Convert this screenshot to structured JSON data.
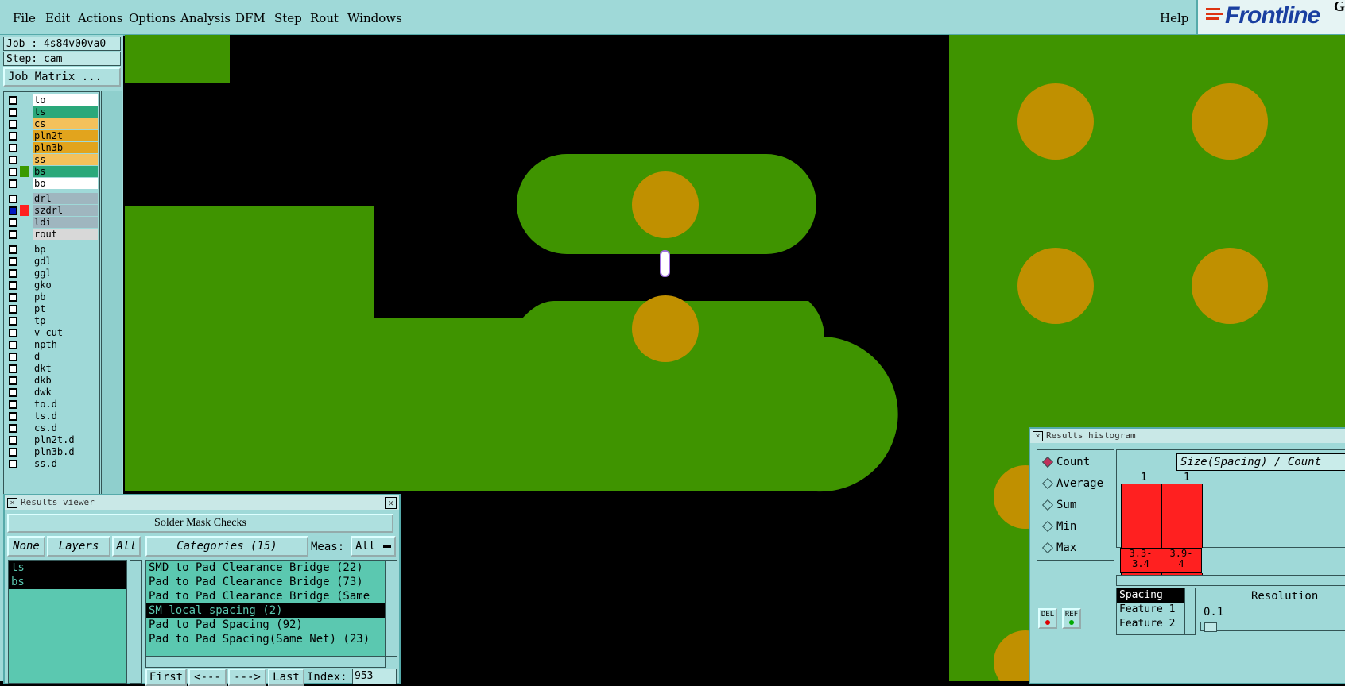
{
  "menubar": {
    "items": [
      "File",
      "Edit",
      "Actions",
      "Options",
      "Analysis",
      "DFM",
      "Step",
      "Rout",
      "Windows"
    ],
    "help": "Help",
    "logo": "Frontline",
    "logo_extra": "G"
  },
  "left_panel": {
    "job": "Job : 4s84v00va0",
    "step": "Step: cam",
    "job_matrix": "Job Matrix ...",
    "layers": [
      {
        "name": "to",
        "color": "#ffffff",
        "swatch": ""
      },
      {
        "name": "ts",
        "color": "#2aa87a",
        "swatch": ""
      },
      {
        "name": "cs",
        "color": "#f4c15b",
        "swatch": ""
      },
      {
        "name": "pln2t",
        "color": "#e2a41d",
        "swatch": ""
      },
      {
        "name": "pln3b",
        "color": "#e2a41d",
        "swatch": ""
      },
      {
        "name": "ss",
        "color": "#f4c15b",
        "swatch": ""
      },
      {
        "name": "bs",
        "color": "#2aa87a",
        "swatch": "#3a9a00"
      },
      {
        "name": "bo",
        "color": "#ffffff",
        "swatch": ""
      },
      {
        "name": "drl",
        "color": "#9fb6bf",
        "swatch": ""
      },
      {
        "name": "szdrl",
        "color": "#9fb6bf",
        "swatch": "#ff2020",
        "selected": true
      },
      {
        "name": "ldi",
        "color": "#9fb6bf",
        "swatch": ""
      },
      {
        "name": "rout",
        "color": "#d8d8d8",
        "swatch": ""
      },
      {
        "name": "bp",
        "color": "#9fd9d8",
        "swatch": ""
      },
      {
        "name": "gdl",
        "color": "#9fd9d8",
        "swatch": ""
      },
      {
        "name": "ggl",
        "color": "#9fd9d8",
        "swatch": ""
      },
      {
        "name": "gko",
        "color": "#9fd9d8",
        "swatch": ""
      },
      {
        "name": "pb",
        "color": "#9fd9d8",
        "swatch": ""
      },
      {
        "name": "pt",
        "color": "#9fd9d8",
        "swatch": ""
      },
      {
        "name": "tp",
        "color": "#9fd9d8",
        "swatch": ""
      },
      {
        "name": "v-cut",
        "color": "#9fd9d8",
        "swatch": ""
      },
      {
        "name": "npth",
        "color": "#9fd9d8",
        "swatch": ""
      },
      {
        "name": "d",
        "color": "#9fd9d8",
        "swatch": ""
      },
      {
        "name": "dkt",
        "color": "#9fd9d8",
        "swatch": ""
      },
      {
        "name": "dkb",
        "color": "#9fd9d8",
        "swatch": ""
      },
      {
        "name": "dwk",
        "color": "#9fd9d8",
        "swatch": ""
      },
      {
        "name": "to.d",
        "color": "#9fd9d8",
        "swatch": ""
      },
      {
        "name": "ts.d",
        "color": "#9fd9d8",
        "swatch": ""
      },
      {
        "name": "cs.d",
        "color": "#9fd9d8",
        "swatch": ""
      },
      {
        "name": "pln2t.d",
        "color": "#9fd9d8",
        "swatch": ""
      },
      {
        "name": "pln3b.d",
        "color": "#9fd9d8",
        "swatch": ""
      },
      {
        "name": "ss.d",
        "color": "#9fd9d8",
        "swatch": ""
      }
    ]
  },
  "canvas": {
    "board_color": "#3f9400",
    "pad_color": "#c09000"
  },
  "results_viewer": {
    "title": "Results viewer",
    "header": "Solder Mask Checks",
    "none_btn": "None",
    "layers_btn": "Layers",
    "all_btn": "All",
    "categories_btn": "Categories (15)",
    "meas_label": "Meas:",
    "meas_value": "All",
    "layers": [
      "ts",
      "bs"
    ],
    "categories": [
      {
        "label": "SMD to Pad Clearance Bridge (22)",
        "selected": false
      },
      {
        "label": "Pad to Pad Clearance Bridge (73)",
        "selected": false
      },
      {
        "label": "Pad to Pad Clearance Bridge (Same",
        "selected": false
      },
      {
        "label": "SM local spacing (2)",
        "selected": true
      },
      {
        "label": "Pad to Pad Spacing (92)",
        "selected": false
      },
      {
        "label": "Pad to Pad Spacing(Same Net) (23)",
        "selected": false
      }
    ],
    "first_btn": "First",
    "prev_btn": "<---",
    "next_btn": "--->",
    "last_btn": "Last",
    "index_label": "Index:",
    "index_value": "953"
  },
  "histogram": {
    "title": "Results histogram",
    "options": [
      {
        "label": "Count",
        "selected": true
      },
      {
        "label": "Average",
        "selected": false
      },
      {
        "label": "Sum",
        "selected": false
      },
      {
        "label": "Min",
        "selected": false
      },
      {
        "label": "Max",
        "selected": false
      }
    ],
    "chart_title": "Size(Spacing) / Count",
    "bars": [
      {
        "count": "1",
        "range": "3.3-\n3.4"
      },
      {
        "count": "1",
        "range": "3.9-\n4"
      }
    ],
    "measures": [
      "Spacing",
      "Feature 1",
      "Feature 2"
    ],
    "resolution_label": "Resolution",
    "resolution_value": "0.1",
    "del_btn": "DEL",
    "ref_btn": "REF"
  }
}
